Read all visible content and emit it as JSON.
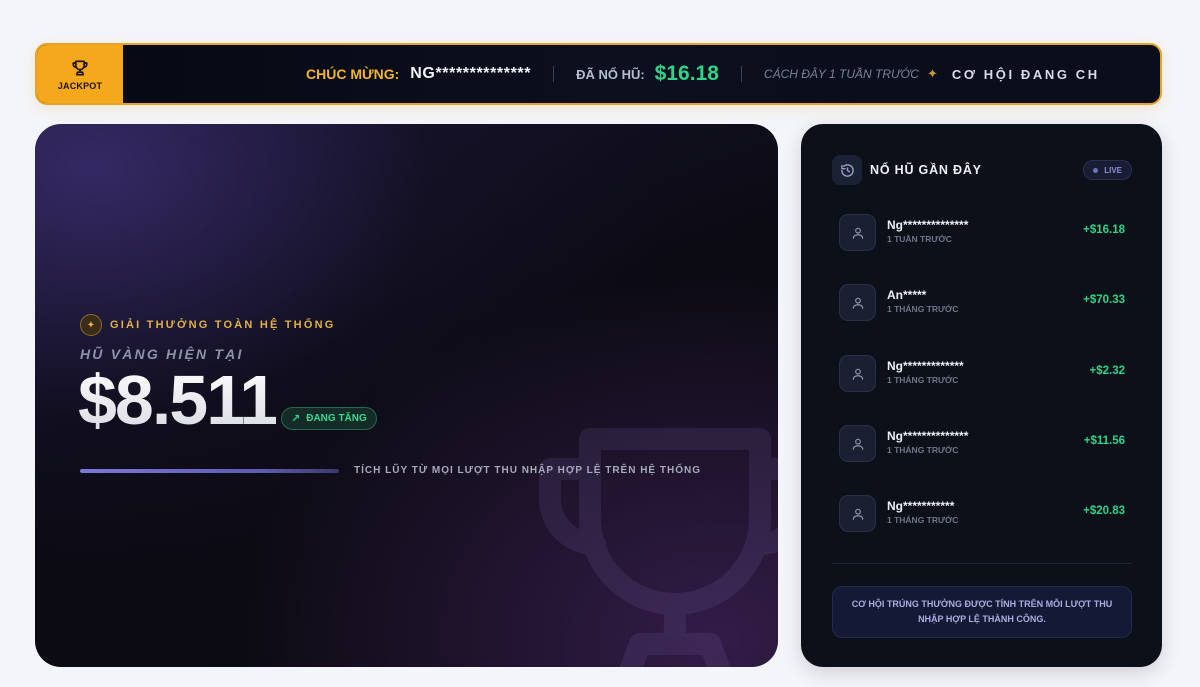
{
  "ticker": {
    "badge_label": "JACKPOT",
    "congrats_label": "CHÚC MỪNG:",
    "user": "NG**************",
    "won_label": "ĐÃ NỔ HŨ:",
    "amount": "$16.18",
    "time": "CÁCH ĐÂY 1 TUẦN TRƯỚC",
    "cta": "CƠ HỘI ĐANG CH"
  },
  "jackpot": {
    "award_label": "GIẢI THƯỞNG TOÀN HỆ THỐNG",
    "subtitle": "HŨ VÀNG HIỆN TẠI",
    "amount": "$8.511",
    "trend_label": "ĐANG TĂNG",
    "progress_fraction": 1.0,
    "note": "TÍCH LŨY TỪ MỌI LƯỢT THU NHẬP HỢP LỆ TRÊN HỆ THỐNG"
  },
  "recent": {
    "title": "NỔ HŨ GẦN ĐÂY",
    "live_label": "LIVE",
    "items": [
      {
        "name": "Ng**************",
        "time": "1 TUẦN TRƯỚC",
        "amount": "+$16.18"
      },
      {
        "name": "An*****",
        "time": "1 THÁNG TRƯỚC",
        "amount": "+$70.33"
      },
      {
        "name": "Ng*************",
        "time": "1 THÁNG TRƯỚC",
        "amount": "+$2.32"
      },
      {
        "name": "Ng**************",
        "time": "1 THÁNG TRƯỚC",
        "amount": "+$11.56"
      },
      {
        "name": "Ng***********",
        "time": "1 THÁNG TRƯỚC",
        "amount": "+$20.83"
      }
    ],
    "footer_note": "CƠ HỘI TRÚNG THƯỞNG ĐƯỢC TÍNH TRÊN MỖI LƯỢT THU NHẬP HỢP LỆ THÀNH CÔNG."
  },
  "colors": {
    "accent_gold": "#f5a81c",
    "win_green": "#2ed488",
    "panel_bg": "#0c1019"
  },
  "icons": {
    "ticker_badge": "trophy-icon",
    "award_chip": "sparkle-icon",
    "trend": "trending-up-icon",
    "recent_head": "history-icon",
    "avatar": "user-icon"
  }
}
